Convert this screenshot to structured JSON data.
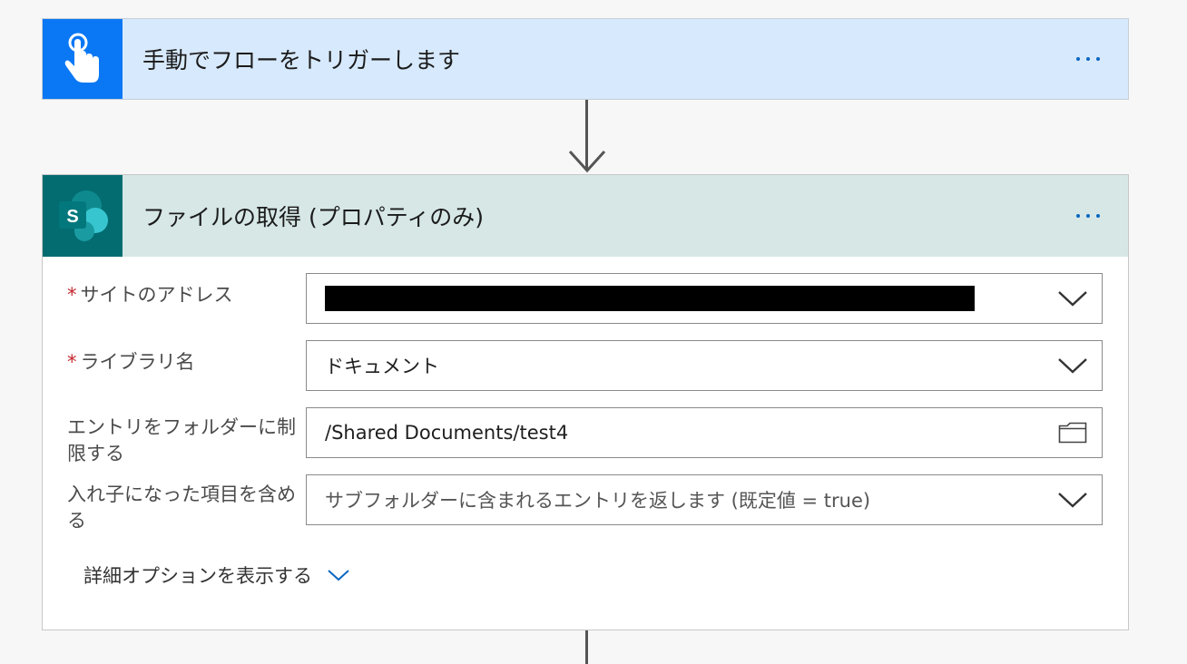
{
  "trigger": {
    "title": "手動でフローをトリガーします",
    "icon": "touch-hand-icon",
    "accent": "#0a78f4",
    "header_bg": "#d7e9fc"
  },
  "action": {
    "title": "ファイルの取得 (プロパティのみ)",
    "icon": "sharepoint-icon",
    "accent": "#036c70",
    "header_bg": "#d6e7e6",
    "fields": [
      {
        "label": "サイトのアドレス",
        "required": true,
        "value": "",
        "redacted": true,
        "control": "dropdown"
      },
      {
        "label": "ライブラリ名",
        "required": true,
        "value": "ドキュメント",
        "control": "dropdown"
      },
      {
        "label": "エントリをフォルダーに制限する",
        "required": false,
        "value": "/Shared Documents/test4",
        "control": "folder-picker"
      },
      {
        "label": "入れ子になった項目を含める",
        "required": false,
        "placeholder": "サブフォルダーに含まれるエントリを返します (既定値 = true)",
        "control": "dropdown"
      }
    ],
    "advanced_label": "詳細オプションを表示する"
  },
  "colors": {
    "required_marker": "#c4262e",
    "more_dots": "#0a66c2"
  }
}
